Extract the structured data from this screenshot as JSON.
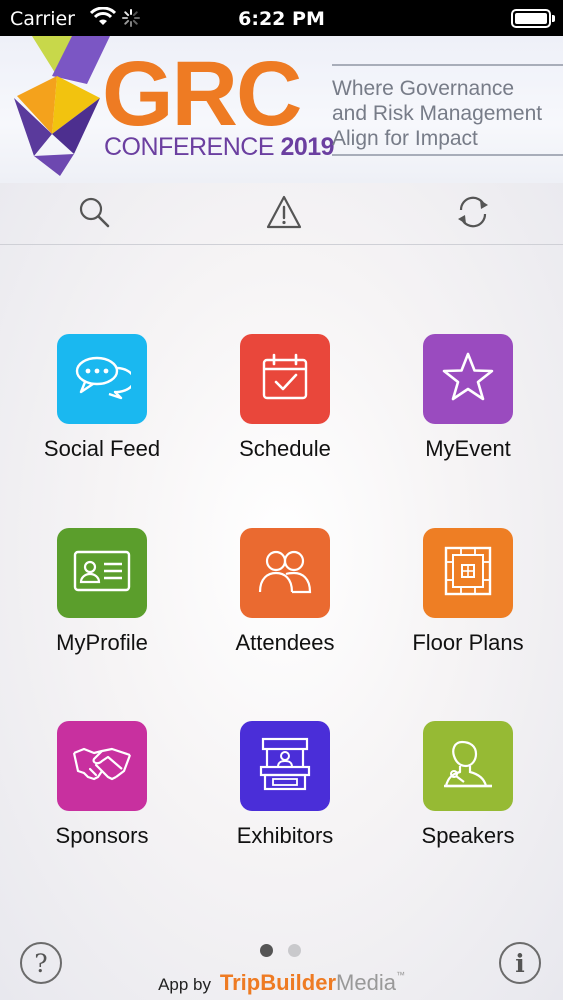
{
  "status_bar": {
    "carrier": "Carrier",
    "time": "6:22 PM"
  },
  "banner": {
    "logo_text": "GRC",
    "conference": "CONFERENCE",
    "year": "2019",
    "tagline_1": "Where Governance",
    "tagline_2": "and Risk Management",
    "tagline_3": "Align for Impact"
  },
  "toolbar": {
    "search_icon": "search-icon",
    "alert_icon": "warning-icon",
    "refresh_icon": "refresh-icon"
  },
  "tiles": [
    {
      "label": "Social Feed",
      "color": "#1ab8f0",
      "icon": "chat-bubbles-icon"
    },
    {
      "label": "Schedule",
      "color": "#e9473b",
      "icon": "calendar-icon"
    },
    {
      "label": "MyEvent",
      "color": "#9a4bbf",
      "icon": "star-icon"
    },
    {
      "label": "MyProfile",
      "color": "#5b9e2c",
      "icon": "id-card-icon"
    },
    {
      "label": "Attendees",
      "color": "#ea6a30",
      "icon": "people-icon"
    },
    {
      "label": "Floor Plans",
      "color": "#ee7e24",
      "icon": "floor-plan-icon"
    },
    {
      "label": "Sponsors",
      "color": "#c8309f",
      "icon": "handshake-icon"
    },
    {
      "label": "Exhibitors",
      "color": "#4a2ed8",
      "icon": "booth-icon"
    },
    {
      "label": "Speakers",
      "color": "#96ba34",
      "icon": "speaker-icon"
    }
  ],
  "footer": {
    "help": "?",
    "info": "i",
    "app_by": "App by",
    "brand_1": "TripBuilder",
    "brand_2": "Media",
    "tm": "™",
    "page_count": 2,
    "active_page": 1
  },
  "colors": {
    "accent_orange": "#ee7b23",
    "purple": "#6b3fa0"
  }
}
